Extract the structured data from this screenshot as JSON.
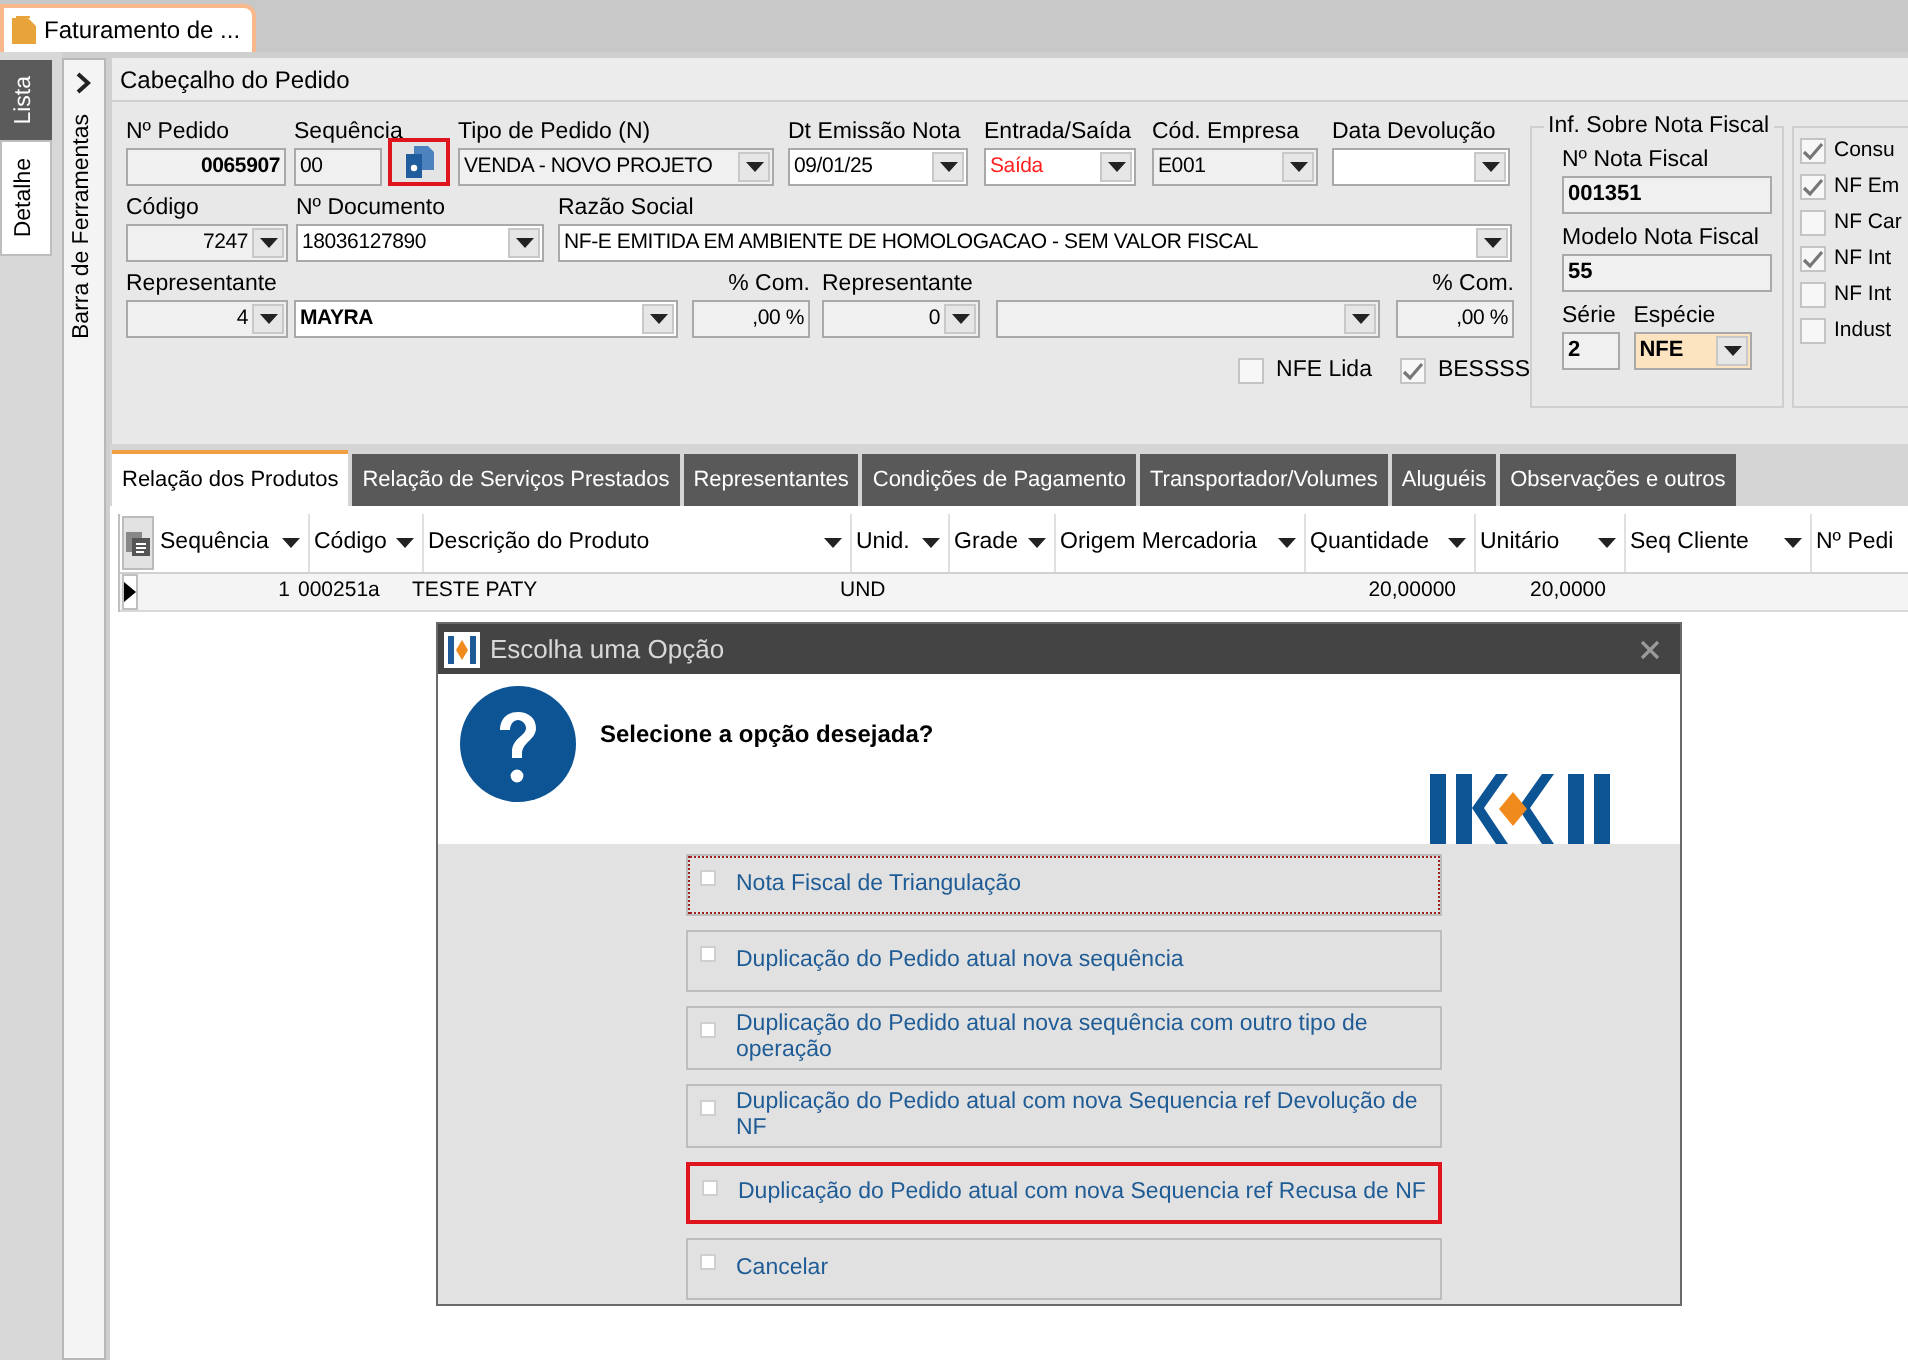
{
  "document_tab": {
    "label": "Faturamento de ...",
    "selected": true
  },
  "side_tabs": [
    {
      "label": "Lista",
      "selected": false
    },
    {
      "label": "Detalhe",
      "selected": true
    }
  ],
  "toolbar": {
    "label": "Barra de Ferramentas"
  },
  "header": {
    "title": "Cabeçalho do Pedido",
    "line_1": {
      "pedido": {
        "label": "Nº Pedido",
        "value": "0065907",
        "bold": true
      },
      "sequencia": {
        "label": "Sequência",
        "value": "00"
      },
      "copy_button": {
        "highlighted": true
      },
      "tipo": {
        "label": "Tipo de Pedido (N)",
        "value": "VENDA - NOVO PROJETO"
      },
      "emissao": {
        "label": "Dt Emissão Nota",
        "value": "09/01/25"
      },
      "entrada_saida": {
        "label": "Entrada/Saída",
        "value": "Saída",
        "alert": true
      },
      "empresa": {
        "label": "Cód. Empresa",
        "value": "E001"
      },
      "devolucao": {
        "label": "Data Devolução"
      }
    },
    "line_2": {
      "codigo": {
        "label": "Código",
        "value": "7247"
      },
      "documento": {
        "label": "Nº Documento",
        "value": "18036127890"
      },
      "razao": {
        "label": "Razão Social",
        "value": "NF-E EMITIDA EM AMBIENTE DE HOMOLOGACAO - SEM VALOR FISCAL"
      }
    },
    "line_3": {
      "representante": {
        "label": "Representante",
        "value": "4"
      },
      "representante_nome": {
        "value": "MAYRA",
        "bold": true
      },
      "comissao": {
        "label": "% Com.",
        "value": ",00 %"
      },
      "representante_2": {
        "label": "Representante",
        "value": "0"
      },
      "comissao_2": {
        "label": "% Com.",
        "value": ",00 %"
      }
    },
    "checks": [
      {
        "label": "NFE Lida",
        "checked": false
      },
      {
        "label": "BESSSS",
        "checked": true
      }
    ]
  },
  "nota_fiscal": {
    "title": "Inf. Sobre Nota Fiscal",
    "numero": {
      "label": "Nº Nota Fiscal",
      "value": "001351"
    },
    "modelo": {
      "label": "Modelo Nota Fiscal",
      "value": "55"
    },
    "serie": {
      "label": "Série",
      "value": "2"
    },
    "especie": {
      "label": "Espécie",
      "value": "NFE"
    }
  },
  "flags": [
    {
      "label": "Consu",
      "checked": true
    },
    {
      "label": "NF Em",
      "checked": true
    },
    {
      "label": "NF Car",
      "checked": false
    },
    {
      "label": "NF Int",
      "checked": true
    },
    {
      "label": "NF Int",
      "checked": false
    },
    {
      "label": "Indust",
      "checked": false
    }
  ],
  "tabs": [
    {
      "label": "Relação dos Produtos",
      "selected": true
    },
    {
      "label": "Relação de Serviços Prestados",
      "selected": false
    },
    {
      "label": "Representantes",
      "selected": false
    },
    {
      "label": "Condições de Pagamento",
      "selected": false
    },
    {
      "label": "Transportador/Volumes",
      "selected": false
    },
    {
      "label": "Aluguéis",
      "selected": false
    },
    {
      "label": "Observações e outros",
      "selected": false
    }
  ],
  "table": {
    "columns": [
      "Sequência",
      "Código",
      "Descrição do Produto",
      "Unid.",
      "Grade",
      "Origem Mercadoria",
      "Quantidade",
      "Unitário",
      "Seq Cliente",
      "Nº Pedi"
    ],
    "rows": [
      {
        "current": true,
        "cells": [
          "1",
          "000251a",
          "TESTE PATY",
          "UND",
          "",
          "",
          "20,00000",
          "20,0000",
          "",
          ""
        ]
      }
    ]
  },
  "dialog": {
    "title": "Escolha uma Opção",
    "message": "Selecione a opção desejada?",
    "options": [
      {
        "label": "Nota Fiscal de Triangulação",
        "focused": true,
        "highlighted": false
      },
      {
        "label": "Duplicação do Pedido atual nova sequência",
        "focused": false,
        "highlighted": false
      },
      {
        "label": "Duplicação do Pedido atual nova sequência com outro tipo de operação",
        "focused": false,
        "highlighted": false
      },
      {
        "label": "Duplicação do Pedido atual com nova Sequencia ref Devolução de NF",
        "focused": false,
        "highlighted": false
      },
      {
        "label": "Duplicação do Pedido atual com nova Sequencia ref Recusa de NF",
        "focused": false,
        "highlighted": true
      },
      {
        "label": "Cancelar",
        "focused": false,
        "highlighted": false
      }
    ]
  }
}
